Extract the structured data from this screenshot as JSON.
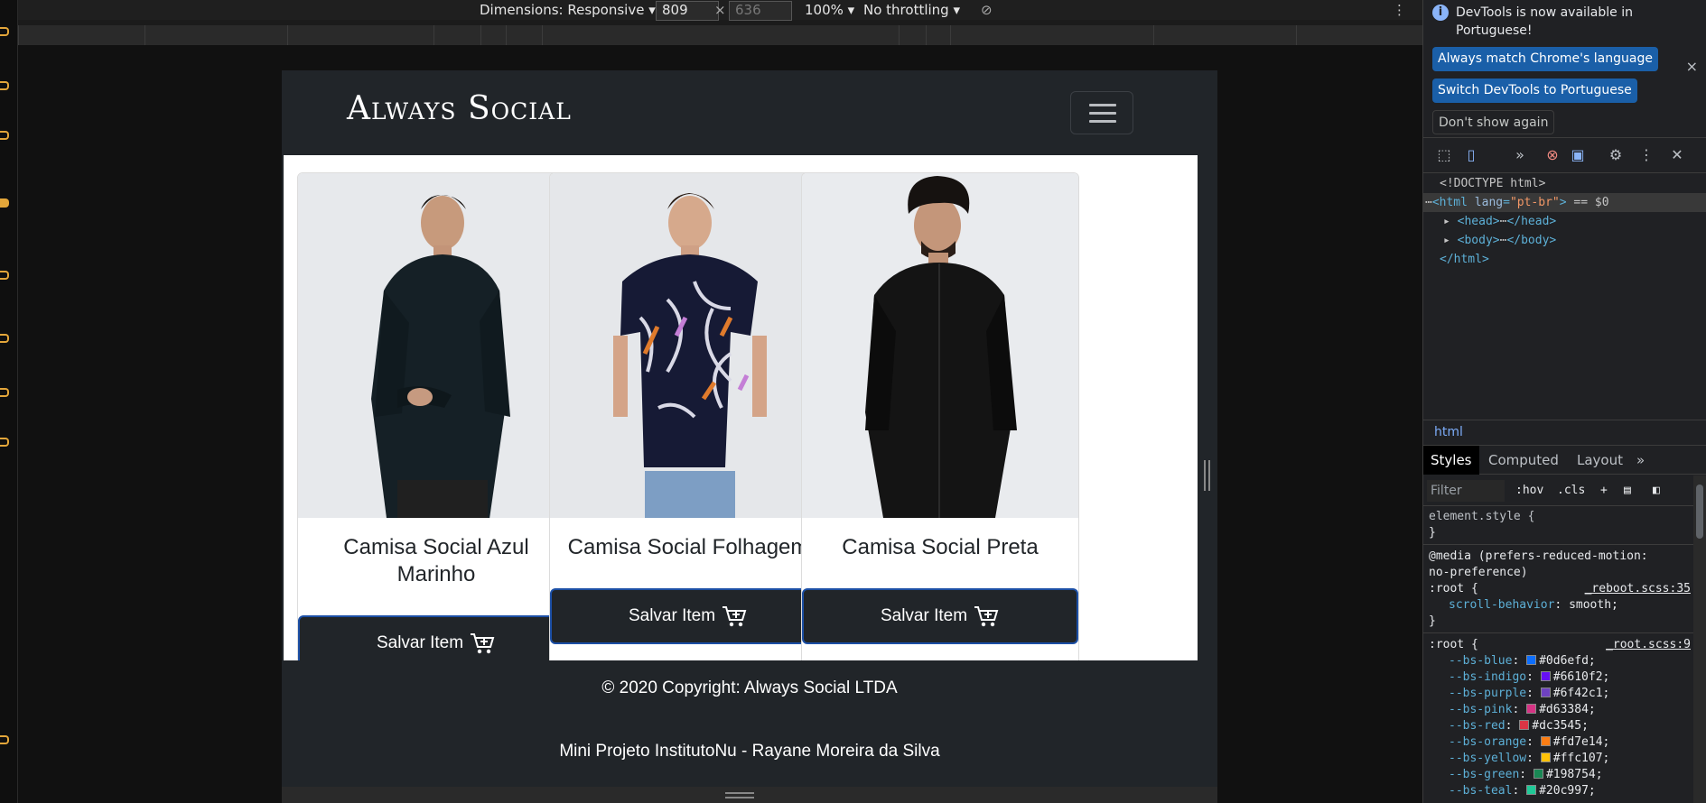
{
  "device_toolbar": {
    "dimensions_label": "Dimensions: Responsive",
    "width": "809",
    "times": "×",
    "height_placeholder": "636",
    "zoom": "100%",
    "throttling": "No throttling",
    "more": "⋮"
  },
  "site": {
    "brand": "Always Social",
    "products": [
      {
        "title": "Camisa Social Azul Marinho",
        "button": "Salvar Item"
      },
      {
        "title": "Camisa Social Folhagem",
        "button": "Salvar Item"
      },
      {
        "title": "Camisa Social Preta",
        "button": "Salvar Item"
      }
    ],
    "footer": {
      "copyright": "© 2020 Copyright: Always Social LTDA",
      "credit": "Mini Projeto InstitutoNu - Rayane Moreira da Silva"
    }
  },
  "devtools": {
    "notice": "DevTools is now available in Portuguese!",
    "match_button": "Always match Chrome's language",
    "switch_button": "Switch DevTools to Portuguese",
    "dismiss_button": "Don't show again",
    "close": "×",
    "dom": {
      "doctype": "<!DOCTYPE html>",
      "html_open_tag": "<html",
      "lang_attr": "lang",
      "lang_value": "\"pt-br\"",
      "html_open_end": ">",
      "selected_marker": "== $0",
      "head_open": "<head>",
      "head_close": "</head>",
      "body_open": "<body>",
      "body_close": "</body>",
      "html_close": "</html>",
      "ellipsis": "⋯",
      "row_dots": "⋯"
    },
    "breadcrumb": "html",
    "tabs": [
      "Styles",
      "Computed",
      "Layout"
    ],
    "tabs_more": "»",
    "filter_placeholder": "Filter",
    "hov": ":hov",
    "cls": ".cls",
    "styles": {
      "element_style": "element.style {",
      "close_brace": "}",
      "media_line1": "@media (prefers-reduced-motion:",
      "media_line2": "no-preference)",
      "root_sel": ":root {",
      "reboot_src": "_reboot.scss:35",
      "scroll_behavior_prop": "scroll-behavior",
      "scroll_behavior_val": "smooth;",
      "root_src": "_root.scss:9",
      "vars": [
        {
          "name": "--bs-blue",
          "value": "#0d6efd;",
          "color": "#0d6efd"
        },
        {
          "name": "--bs-indigo",
          "value": "#6610f2;",
          "color": "#6610f2"
        },
        {
          "name": "--bs-purple",
          "value": "#6f42c1;",
          "color": "#6f42c1"
        },
        {
          "name": "--bs-pink",
          "value": "#d63384;",
          "color": "#d63384"
        },
        {
          "name": "--bs-red",
          "value": "#dc3545;",
          "color": "#dc3545"
        },
        {
          "name": "--bs-orange",
          "value": "#fd7e14;",
          "color": "#fd7e14"
        },
        {
          "name": "--bs-yellow",
          "value": "#ffc107;",
          "color": "#ffc107"
        },
        {
          "name": "--bs-green",
          "value": "#198754;",
          "color": "#198754"
        },
        {
          "name": "--bs-teal",
          "value": "#20c997;",
          "color": "#20c997"
        }
      ]
    }
  }
}
